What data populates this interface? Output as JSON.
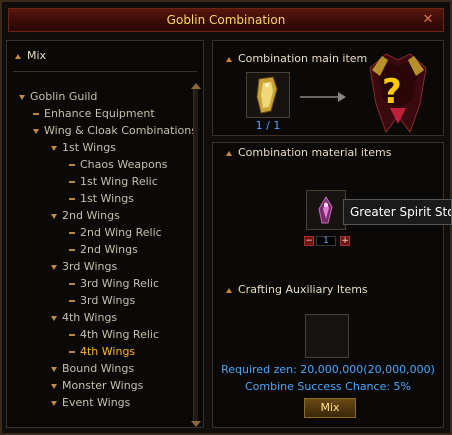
{
  "window": {
    "title": "Goblin Combination"
  },
  "left_panel": {
    "header": "Mix",
    "tree": [
      {
        "label": "Goblin Guild",
        "depth": 0,
        "marker": "triangle"
      },
      {
        "label": "Enhance Equipment",
        "depth": 1,
        "marker": "dash"
      },
      {
        "label": "Wing & Cloak Combinations",
        "depth": 1,
        "marker": "triangle"
      },
      {
        "label": "1st Wings",
        "depth": 2,
        "marker": "triangle"
      },
      {
        "label": "Chaos Weapons",
        "depth": 3,
        "marker": "dash"
      },
      {
        "label": "1st Wing Relic",
        "depth": 3,
        "marker": "dash"
      },
      {
        "label": "1st Wings",
        "depth": 3,
        "marker": "dash"
      },
      {
        "label": "2nd Wings",
        "depth": 2,
        "marker": "triangle"
      },
      {
        "label": "2nd Wing Relic",
        "depth": 3,
        "marker": "dash"
      },
      {
        "label": "2nd Wings",
        "depth": 3,
        "marker": "dash"
      },
      {
        "label": "3rd Wings",
        "depth": 2,
        "marker": "triangle"
      },
      {
        "label": "3rd Wing Relic",
        "depth": 3,
        "marker": "dash"
      },
      {
        "label": "3rd Wings",
        "depth": 3,
        "marker": "dash"
      },
      {
        "label": "4th Wings",
        "depth": 2,
        "marker": "triangle"
      },
      {
        "label": "4th Wing Relic",
        "depth": 3,
        "marker": "dash"
      },
      {
        "label": "4th Wings",
        "depth": 3,
        "marker": "dash",
        "selected": true
      },
      {
        "label": "Bound Wings",
        "depth": 2,
        "marker": "triangle"
      },
      {
        "label": "Monster Wings",
        "depth": 2,
        "marker": "triangle"
      },
      {
        "label": "Event Wings",
        "depth": 2,
        "marker": "triangle"
      }
    ]
  },
  "main_item": {
    "section_title": "Combination main item",
    "count": "1 / 1",
    "result_placeholder": "?"
  },
  "materials": {
    "section_title": "Combination material items",
    "tooltip": "Greater Spirit Stone",
    "quantity": "1",
    "minus": "−",
    "plus": "+"
  },
  "auxiliary": {
    "section_title": "Crafting Auxiliary Items"
  },
  "footer": {
    "required_zen": "Required zen: 20,000,000(20,000,000)",
    "success_chance": "Combine Success Chance: 5%",
    "mix_button": "Mix"
  },
  "colors": {
    "accent_gold": "#ffb428",
    "info_blue": "#4aa8ff",
    "title_bar": "#5a150d"
  }
}
